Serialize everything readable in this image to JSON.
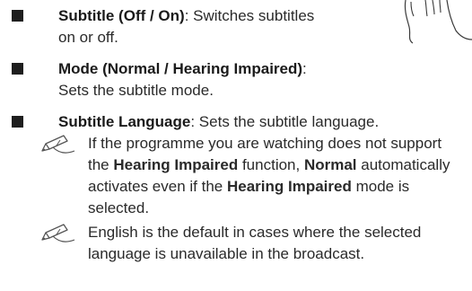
{
  "items": [
    {
      "title": "Subtitle (Off / On)",
      "sep": ": ",
      "line1_rest": "Switches subtitles",
      "line2": "on or off."
    },
    {
      "title": "Mode (Normal / Hearing Impaired)",
      "sep": ":",
      "line2": "Sets the subtitle mode."
    },
    {
      "title": "Subtitle Language",
      "sep": ": ",
      "line1_rest": "Sets the subtitle language."
    }
  ],
  "notes": [
    {
      "parts": [
        {
          "t": "If the programme you are watching does not support the ",
          "b": false
        },
        {
          "t": "Hearing Impaired",
          "b": true
        },
        {
          "t": " function, ",
          "b": false
        },
        {
          "t": "Normal",
          "b": true
        },
        {
          "t": " automatically activates even if the ",
          "b": false
        },
        {
          "t": "Hearing Impaired",
          "b": true
        },
        {
          "t": " mode is selected.",
          "b": false
        }
      ]
    },
    {
      "parts": [
        {
          "t": "English is the default in cases where the selected language is unavailable in the broadcast.",
          "b": false
        }
      ]
    }
  ],
  "icons": {
    "note": "pencil-note-icon",
    "hand": "hand-illustration"
  }
}
